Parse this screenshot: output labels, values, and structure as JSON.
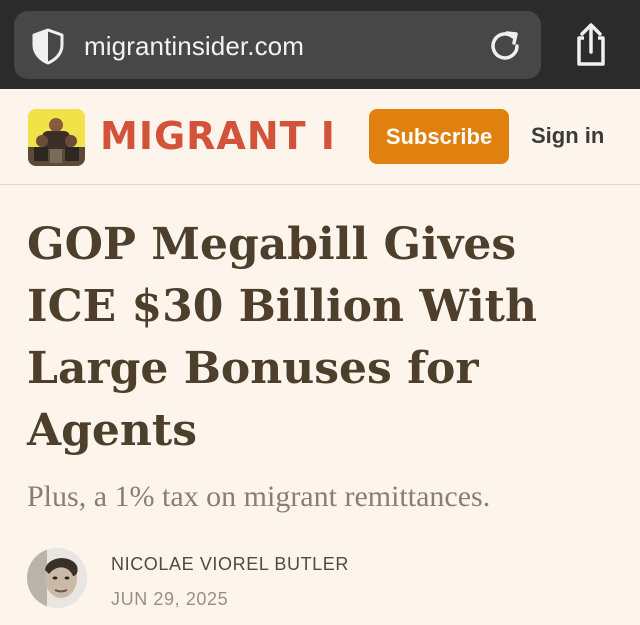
{
  "browser": {
    "url": "migrantinsider.com"
  },
  "header": {
    "brand": "MIGRANT I",
    "subscribe_label": "Subscribe",
    "signin_label": "Sign in"
  },
  "article": {
    "title": "GOP Megabill Gives ICE $30 Billion With Large Bonuses for Agents",
    "subtitle": "Plus, a 1% tax on migrant remittances.",
    "author": "NICOLAE VIOREL BUTLER",
    "date": "JUN 29, 2025"
  },
  "colors": {
    "chrome_bg": "#2b2b2b",
    "page_bg": "#fdf5ec",
    "brand": "#d2523a",
    "subscribe_bg": "#e0810f",
    "headline": "#4e3f2c"
  },
  "icons": [
    "shield-icon",
    "reload-icon",
    "share-icon"
  ]
}
